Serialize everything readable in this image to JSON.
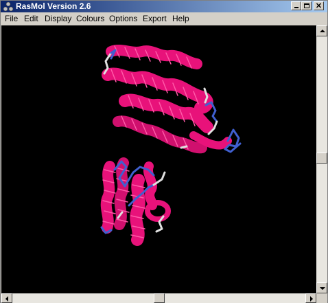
{
  "window": {
    "title": "RasMol Version 2.6",
    "icons": {
      "app": "rasmol-molecule-icon",
      "minimize": "minimize-icon",
      "maximize": "maximize-icon",
      "close": "close-icon"
    }
  },
  "menu": [
    "File",
    "Edit",
    "Display",
    "Colours",
    "Options",
    "Export",
    "Help"
  ],
  "colors": {
    "helix": "#e8127a",
    "turn": "#4060d0",
    "coil": "#e0e0e0",
    "background": "#000000",
    "titlebar_start": "#0a246a"
  },
  "scrollbars": {
    "vertical": {
      "thumb_fraction": 0.5
    },
    "horizontal": {
      "thumb_fraction": 0.5
    }
  }
}
